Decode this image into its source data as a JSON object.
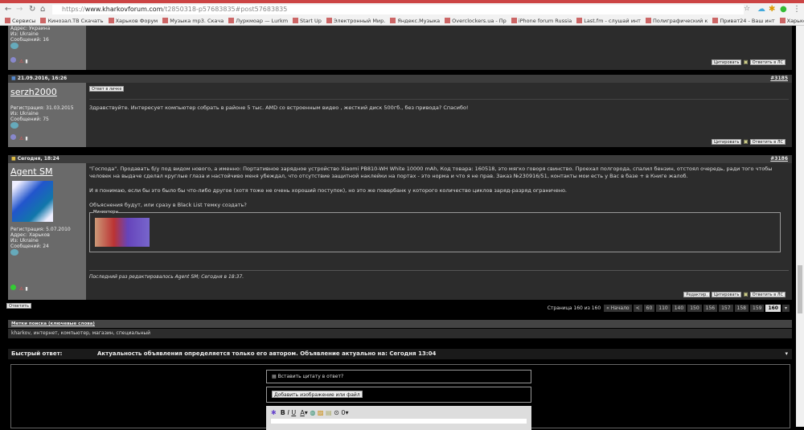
{
  "browser": {
    "url_domain": "www.kharkovforum.com",
    "url_prefix": "https://",
    "url_path": "/t2850318-p57683835#post57683835",
    "bookmarks": [
      "Сервисы",
      "Кинозал.TB Скачать",
      "Харьков Форум",
      "Музыка mp3. Скача",
      "Луркмоар — Lurkm",
      "Start Up",
      "Электронный Мир.",
      "Яндекс.Музыка",
      "Overclockers.ua - Пр",
      "iPhone forum Russia",
      "Last.fm - слушай инт",
      "Полиграфический к",
      "Приват24 - Ваш инт",
      "Харьковоблэнерго"
    ]
  },
  "post1": {
    "address": "Адрес: Украина",
    "from": "Из: Ukraine",
    "messages": "Сообщений: 16",
    "quote": "Цитировать",
    "reply_pm": "Ответить в ЛС"
  },
  "post2": {
    "date": "21.09.2016, 16:26",
    "number": "#3185",
    "username": "serzh2000",
    "reg": "Регистрация: 31.03.2015",
    "from": "Из: Ukraine",
    "messages": "Сообщений: 75",
    "reply_private": "Ответ в личке",
    "text": "Здравствуйте. Интересует компьютер собрать в районе 5 тыс. AMD со встроенным видео , жесткий диск 500гб., без привода? Спасибо!",
    "quote": "Цитировать",
    "reply_pm": "Ответить в ЛС"
  },
  "post3": {
    "date": "Сегодня, 18:24",
    "number": "#3186",
    "username": "Agent SM",
    "reg": "Регистрация: 5.07.2010",
    "address": "Адрес: Харьков",
    "from": "Из: Ukraine",
    "messages": "Сообщений: 24",
    "p1": "\"Господа\". Продавать б/у под видом нового, а именно: Портативное зарядное устройство Xiaomi PB810-WH White 10000 mAh, Код товара: 160518, это мягко говоря свинство. Проехал полгорода, спалил бензин, отстоял очередь, ради того чтобы человек на выдаче сделал круглые глаза и настойчиво меня убеждал, что отсутствие защитной наклейки на портах - это норма и что я не прав. Заказ №230916/51, контакты мои есть у Вас в базе + в Книге жалоб.",
    "p2": "И я понимаю, если бы это было бы что-либо другое (хотя тоже не очень хороший поступок), но это же повербанк у которого количество циклов заряд-разряд ограничено.",
    "p3": "Объяснения будут, или сразу в Black List темку создать?",
    "thumbs_label": "Миниатюры",
    "edited_link": "Последний раз редактировалось Agent SM",
    "edited_time": "; Сегодня в 18:37.",
    "edit": "Редактир.",
    "quote": "Цитировать",
    "reply_pm": "Ответить в ЛС"
  },
  "reply_button": "Ответить",
  "pagination": {
    "label": "Страница 160 из 160",
    "first": "« Начало",
    "prev": "<",
    "pages": [
      "60",
      "110",
      "140",
      "150",
      "156",
      "157",
      "158",
      "159",
      "160"
    ]
  },
  "tags": {
    "title": "Метки поиска (ключевые слова)",
    "items": [
      "kharkov",
      "интернет",
      "компьютер",
      "магазин",
      "специальный"
    ]
  },
  "quick_reply": {
    "title": "Быстрый ответ:",
    "notice": "Актуальность объявления определяется только его автором. Объявление актуально на: Сегодня 13:04",
    "quote_checkbox": "Вставить цитату в ответ?",
    "add_file": "Добавить изображение или файл"
  }
}
